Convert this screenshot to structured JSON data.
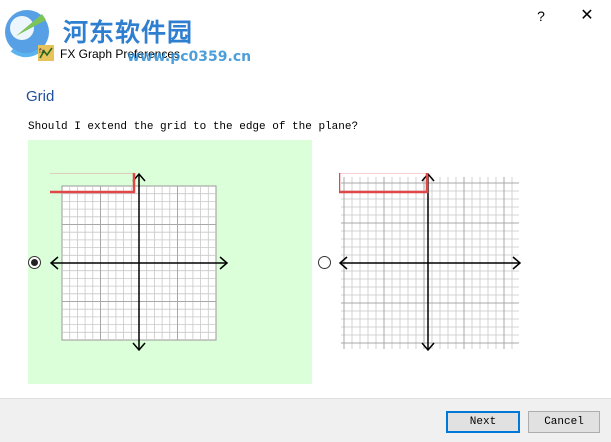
{
  "window": {
    "title": "FX Graph Preferences",
    "help_glyph": "?",
    "close_glyph": "✕"
  },
  "watermark": {
    "site_name": "河东软件园",
    "url": "www.pc0359.cn"
  },
  "page": {
    "section_title": "Grid",
    "question": "Should I extend the grid to the edge of the plane?"
  },
  "options": [
    {
      "selected": true,
      "variant": "grid-contained"
    },
    {
      "selected": false,
      "variant": "grid-extended"
    }
  ],
  "colors": {
    "selected_panel": "#dbffd9",
    "highlight_box": "#e04848",
    "section_title": "#1f4e9c"
  },
  "footer": {
    "next_label": "Next",
    "cancel_label": "Cancel"
  }
}
